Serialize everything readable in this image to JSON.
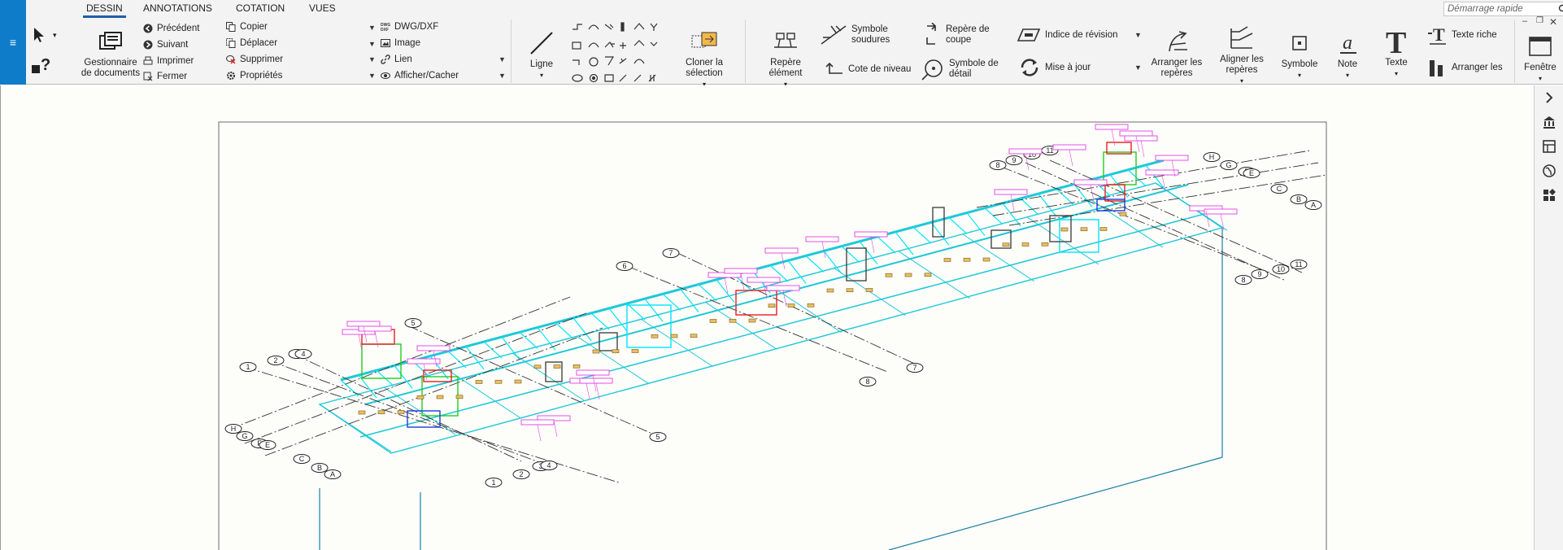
{
  "ribbon": {
    "tabs": [
      {
        "label": "DESSIN",
        "active": true
      },
      {
        "label": "ANNOTATIONS",
        "active": false
      },
      {
        "label": "COTATION",
        "active": false
      },
      {
        "label": "VUES",
        "active": false
      }
    ],
    "doc_manager": {
      "label_line1": "Gestionnaire",
      "label_line2": "de documents"
    },
    "nav": {
      "previous": "Précédent",
      "next": "Suivant",
      "print": "Imprimer",
      "close": "Fermer"
    },
    "edit": {
      "copy": "Copier",
      "move": "Déplacer",
      "delete": "Supprimer",
      "properties": "Propriétés"
    },
    "insert": {
      "dwg": "DWG/DXF",
      "image": "Image",
      "link": "Lien",
      "show_hide": "Afficher/Cacher"
    },
    "line": {
      "label": "Ligne"
    },
    "clone": {
      "label_line1": "Cloner la",
      "label_line2": "sélection"
    },
    "element_mark": {
      "label_line1": "Repère",
      "label_line2": "élément"
    },
    "weld": {
      "label_line1": "Symbole",
      "label_line2": "soudures"
    },
    "level": {
      "label": "Cote de niveau"
    },
    "section": {
      "label_line1": "Repère de",
      "label_line2": "coupe"
    },
    "detail": {
      "label_line1": "Symbole de",
      "label_line2": "détail"
    },
    "revision": {
      "label": "Indice de révision"
    },
    "update": {
      "label": "Mise à jour"
    },
    "arrange_marks": {
      "label_line1": "Arranger les",
      "label_line2": "repères"
    },
    "align_marks": {
      "label_line1": "Aligner les",
      "label_line2": "repères"
    },
    "symbol": {
      "label": "Symbole"
    },
    "note": {
      "label": "Note"
    },
    "text": {
      "label": "Texte"
    },
    "rich_text": {
      "label": "Texte riche"
    },
    "arrange": {
      "label": "Arranger les"
    },
    "window": {
      "label": "Fenêtre"
    }
  },
  "search": {
    "placeholder": "Démarrage rapide"
  },
  "window_controls": {
    "minimize": "–",
    "restore": "❐",
    "close": "✕"
  },
  "app_menu": {
    "glyph": "≡"
  },
  "drawing": {
    "grid_labels_left": [
      "1",
      "2",
      "3",
      "4",
      "5",
      "H",
      "G",
      "F",
      "E",
      "C",
      "B",
      "A"
    ],
    "grid_labels_mid": [
      "6",
      "7",
      "8",
      "7",
      "5"
    ],
    "grid_labels_right": [
      "8",
      "9",
      "10",
      "11",
      "H",
      "G",
      "F",
      "E",
      "C",
      "B",
      "A",
      "8",
      "9",
      "10",
      "11"
    ],
    "grid_labels_bottom": [
      "1",
      "2",
      "3",
      "4"
    ]
  },
  "colors": {
    "accent": "#0e7cc8",
    "frame": "#1ec8d8",
    "cyan": "#00e5ff",
    "magenta": "#e040e0",
    "red": "#e52020",
    "green": "#22cc22",
    "blue": "#1a3cd8"
  }
}
